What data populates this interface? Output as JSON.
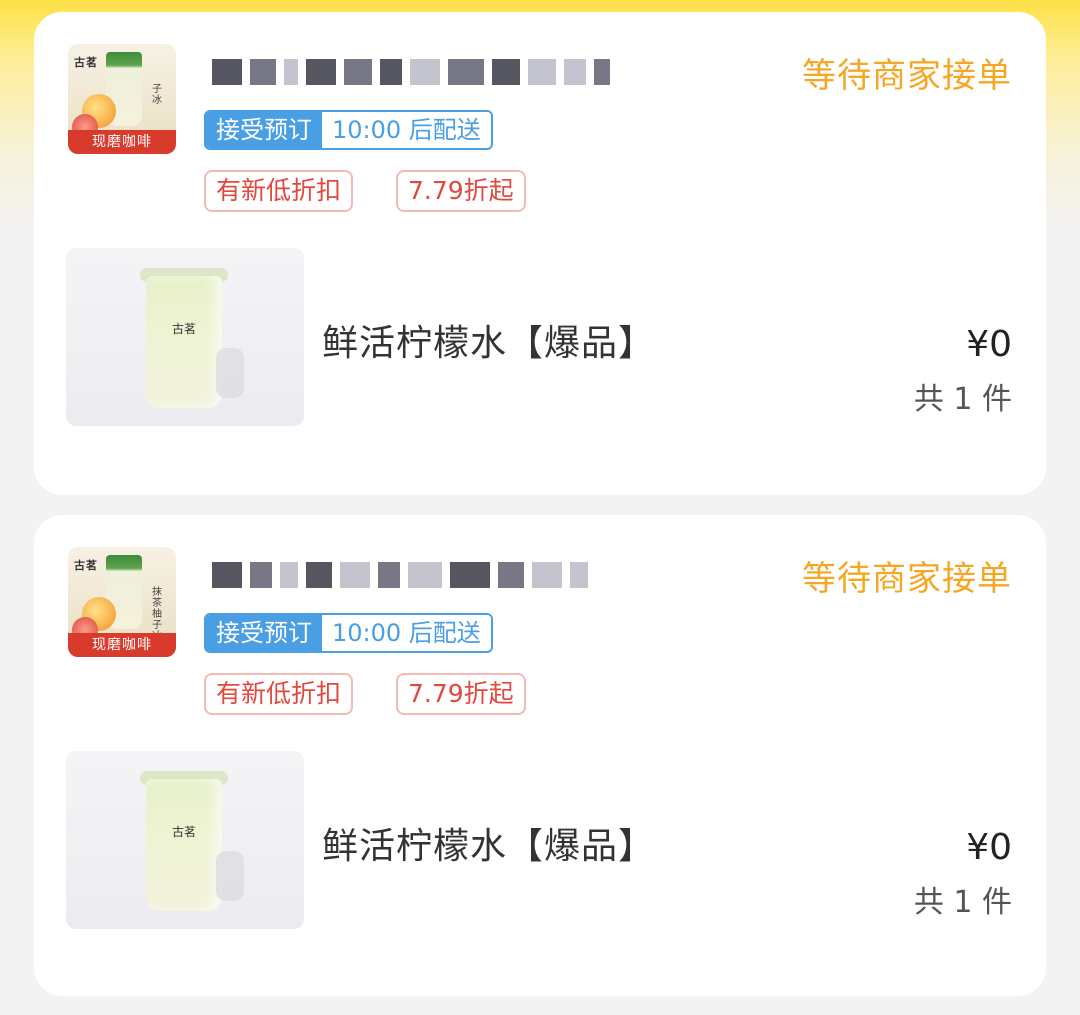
{
  "orders": [
    {
      "store": {
        "logo_brand": "古茗",
        "logo_side_text": "子冰",
        "logo_banner": "现磨咖啡"
      },
      "status": "等待商家接单",
      "delivery": {
        "type": "接受预订",
        "time": "10:00 后配送"
      },
      "promos": [
        "有新低折扣",
        "7.79折起"
      ],
      "product": {
        "cup_brand": "古茗",
        "name": "鲜活柠檬水【爆品】",
        "price": "¥0",
        "count": "共 1 件"
      }
    },
    {
      "store": {
        "logo_brand": "古茗",
        "logo_side_text": "抹茶柚子冰",
        "logo_banner": "现磨咖啡"
      },
      "status": "等待商家接单",
      "delivery": {
        "type": "接受预订",
        "time": "10:00 后配送"
      },
      "promos": [
        "有新低折扣",
        "7.79折起"
      ],
      "product": {
        "cup_brand": "古茗",
        "name": "鲜活柠檬水【爆品】",
        "price": "¥0",
        "count": "共 1 件"
      }
    }
  ],
  "colors": {
    "status": "#f5a623",
    "delivery_blue": "#4a9ee3",
    "promo_red": "#e2483d",
    "header_yellow": "#fde146"
  }
}
